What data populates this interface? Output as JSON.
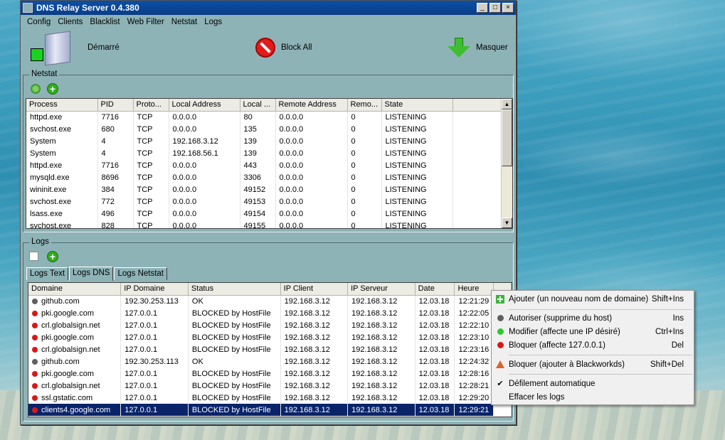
{
  "window": {
    "title": "DNS Relay Server 0.4.380",
    "controls": [
      "_",
      "□",
      "×"
    ]
  },
  "menu": [
    "Config",
    "Clients",
    "Blacklist",
    "Web Filter",
    "Netstat",
    "Logs"
  ],
  "toolbar": {
    "status_label": "Démarré",
    "block_label": "Block All",
    "hide_label": "Masquer"
  },
  "netstat": {
    "legend": "Netstat",
    "columns": [
      "Process",
      "PID",
      "Proto...",
      "Local Address",
      "Local ...",
      "Remote Address",
      "Remo...",
      "State",
      ""
    ],
    "rows": [
      [
        "httpd.exe",
        "7716",
        "TCP",
        "0.0.0.0",
        "80",
        "0.0.0.0",
        "0",
        "LISTENING"
      ],
      [
        "svchost.exe",
        "680",
        "TCP",
        "0.0.0.0",
        "135",
        "0.0.0.0",
        "0",
        "LISTENING"
      ],
      [
        "System",
        "4",
        "TCP",
        "192.168.3.12",
        "139",
        "0.0.0.0",
        "0",
        "LISTENING"
      ],
      [
        "System",
        "4",
        "TCP",
        "192.168.56.1",
        "139",
        "0.0.0.0",
        "0",
        "LISTENING"
      ],
      [
        "httpd.exe",
        "7716",
        "TCP",
        "0.0.0.0",
        "443",
        "0.0.0.0",
        "0",
        "LISTENING"
      ],
      [
        "mysqld.exe",
        "8696",
        "TCP",
        "0.0.0.0",
        "3306",
        "0.0.0.0",
        "0",
        "LISTENING"
      ],
      [
        "wininit.exe",
        "384",
        "TCP",
        "0.0.0.0",
        "49152",
        "0.0.0.0",
        "0",
        "LISTENING"
      ],
      [
        "svchost.exe",
        "772",
        "TCP",
        "0.0.0.0",
        "49153",
        "0.0.0.0",
        "0",
        "LISTENING"
      ],
      [
        "lsass.exe",
        "496",
        "TCP",
        "0.0.0.0",
        "49154",
        "0.0.0.0",
        "0",
        "LISTENING"
      ],
      [
        "svchost.exe",
        "828",
        "TCP",
        "0.0.0.0",
        "49155",
        "0.0.0.0",
        "0",
        "LISTENING"
      ]
    ]
  },
  "logs": {
    "legend": "Logs",
    "tabs": [
      "Logs Text",
      "Logs DNS",
      "Logs Netstat"
    ],
    "active_tab": "Logs DNS",
    "columns": [
      "Domaine",
      "IP Domaine",
      "Status",
      "IP Client",
      "IP Serveur",
      "Date",
      "Heure"
    ],
    "rows": [
      {
        "status_color": "gray",
        "cells": [
          "github.com",
          "192.30.253.113",
          "OK",
          "192.168.3.12",
          "192.168.3.12",
          "12.03.18",
          "12:21:29"
        ]
      },
      {
        "status_color": "red",
        "cells": [
          "pki.google.com",
          "127.0.0.1",
          "BLOCKED by HostFile",
          "192.168.3.12",
          "192.168.3.12",
          "12.03.18",
          "12:22:05"
        ]
      },
      {
        "status_color": "red",
        "cells": [
          "crl.globalsign.net",
          "127.0.0.1",
          "BLOCKED by HostFile",
          "192.168.3.12",
          "192.168.3.12",
          "12.03.18",
          "12:22:10"
        ]
      },
      {
        "status_color": "red",
        "cells": [
          "pki.google.com",
          "127.0.0.1",
          "BLOCKED by HostFile",
          "192.168.3.12",
          "192.168.3.12",
          "12.03.18",
          "12:23:10"
        ]
      },
      {
        "status_color": "red",
        "cells": [
          "crl.globalsign.net",
          "127.0.0.1",
          "BLOCKED by HostFile",
          "192.168.3.12",
          "192.168.3.12",
          "12.03.18",
          "12:23:16"
        ]
      },
      {
        "status_color": "gray",
        "cells": [
          "github.com",
          "192.30.253.113",
          "OK",
          "192.168.3.12",
          "192.168.3.12",
          "12.03.18",
          "12:24:32"
        ]
      },
      {
        "status_color": "red",
        "cells": [
          "pki.google.com",
          "127.0.0.1",
          "BLOCKED by HostFile",
          "192.168.3.12",
          "192.168.3.12",
          "12.03.18",
          "12:28:16"
        ]
      },
      {
        "status_color": "red",
        "cells": [
          "crl.globalsign.net",
          "127.0.0.1",
          "BLOCKED by HostFile",
          "192.168.3.12",
          "192.168.3.12",
          "12.03.18",
          "12:28:21"
        ]
      },
      {
        "status_color": "red",
        "cells": [
          "ssl.gstatic.com",
          "127.0.0.1",
          "BLOCKED by HostFile",
          "192.168.3.12",
          "192.168.3.12",
          "12.03.18",
          "12:29:20"
        ]
      },
      {
        "status_color": "red",
        "selected": true,
        "cells": [
          "clients4.google.com",
          "127.0.0.1",
          "BLOCKED by HostFile",
          "192.168.3.12",
          "192.168.3.12",
          "12.03.18",
          "12:29:21"
        ]
      }
    ]
  },
  "context_menu": {
    "items": [
      {
        "icon": "add",
        "label": "Ajouter (un nouveau nom de domaine)",
        "shortcut": "Shift+Ins"
      },
      {
        "icon": "dot-gray",
        "label": "Autoriser (supprime du host)",
        "shortcut": "Ins"
      },
      {
        "icon": "dot-green",
        "label": "Modifier (affecte une IP désiré)",
        "shortcut": "Ctrl+Ins"
      },
      {
        "icon": "dot-red",
        "label": "Bloquer (affecte 127.0.0.1)",
        "shortcut": "Del"
      },
      {
        "icon": "warning",
        "label": "Bloquer (ajouter à Blackworkds)",
        "shortcut": "Shift+Del"
      },
      {
        "icon": "check",
        "label": "Défilement automatique",
        "shortcut": ""
      },
      {
        "icon": "",
        "label": "Effacer les logs",
        "shortcut": ""
      }
    ]
  },
  "colors": {
    "window_bg": "#8eb3b7",
    "title_bar": "#0b4fa6",
    "selection": "#0a246a",
    "red": "#d81818",
    "gray": "#606060",
    "green": "#2ec92e"
  }
}
